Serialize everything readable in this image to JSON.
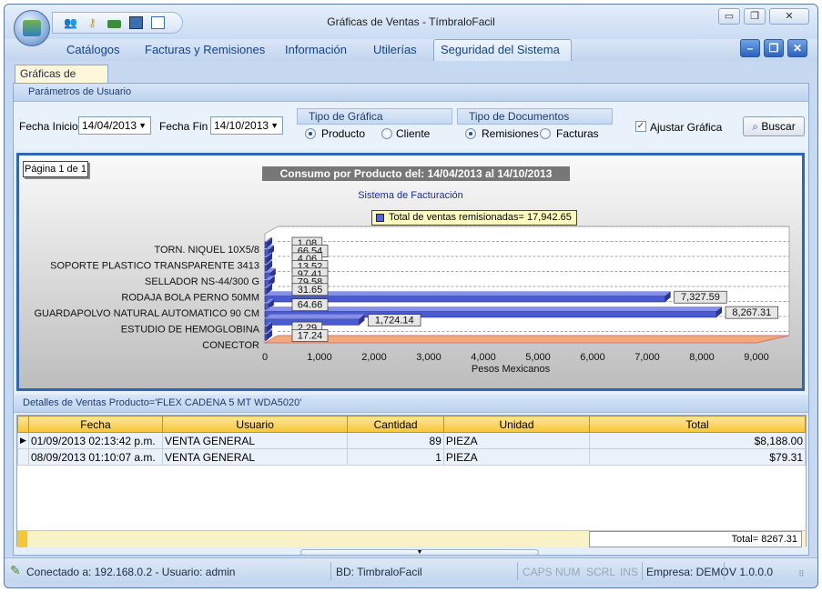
{
  "window": {
    "title": "Gráficas de Ventas - TímbraloFacil",
    "controls": {
      "minimize": "▭",
      "restore": "❐",
      "close": "✕"
    }
  },
  "quick_access": [
    "users-icon",
    "key-icon",
    "money-icon",
    "calculator-icon",
    "document-icon"
  ],
  "menu": [
    "Catálogos",
    "Facturas y Remisiones",
    "Información",
    "Utilerías",
    "Seguridad del Sistema"
  ],
  "mdi_controls": {
    "minimize": "–",
    "restore": "❐",
    "close": "✕"
  },
  "doc_tab": "Gráficas de Ventas",
  "params": {
    "header": "Parámetros de Usuario",
    "fecha_inicio_label": "Fecha Inicio",
    "fecha_inicio": "14/04/2013",
    "fecha_fin_label": "Fecha Fin",
    "fecha_fin": "14/10/2013",
    "tipo_grafica": {
      "title": "Tipo de Gráfica",
      "opt1": "Producto",
      "opt2": "Cliente",
      "selected": "Producto"
    },
    "tipo_docs": {
      "title": "Tipo de Documentos",
      "opt1": "Remisiones",
      "opt2": "Facturas",
      "selected": "Remisiones"
    },
    "ajustar": "Ajustar Gráfica",
    "ajustar_checked": true,
    "buscar": "Buscar"
  },
  "chart_data": {
    "type": "bar",
    "orientation": "horizontal",
    "page_label": "Página 1 de 1",
    "title": "Consumo por Producto del: 14/04/2013 al 14/10/2013",
    "subtitle": "Sistema de Facturación",
    "legend": "Total de ventas remisionadas= 17,942.65",
    "xlabel": "Pesos Mexicanos",
    "xlim": [
      0,
      9000
    ],
    "xticks": [
      "0",
      "1,000",
      "2,000",
      "3,000",
      "4,000",
      "5,000",
      "6,000",
      "7,000",
      "8,000",
      "9,000"
    ],
    "categories": [
      "TORN. NIQUEL 10X5/8",
      "SOPORTE PLASTICO TRANSPARENTE 3413",
      "SELLADOR NS-44/300 G",
      "RODAJA BOLA PERNO 50MM",
      "GUARDAPOLVO NATURAL AUTOMATICO 90 CM",
      "ESTUDIO DE HEMOGLOBINA",
      "CONECTOR"
    ],
    "values": [
      1.08,
      66.54,
      4.06,
      13.52,
      97.41,
      79.58,
      31.65,
      7327.59,
      64.66,
      8267.31,
      1724.14,
      2.29,
      17.24
    ],
    "value_labels": [
      "1.08",
      "66.54",
      "4.06",
      "13.52",
      "97.41",
      "79.58",
      "31.65",
      "7,327.59",
      "64.66",
      "8,267.31",
      "1,724.14",
      "2.29",
      "17.24"
    ],
    "grid": true,
    "bar_color": "#4a5bd0",
    "floor_color": "#f4a97a"
  },
  "detail": {
    "header": "Detalles de Ventas Producto='FLEX CADENA 5 MT WDA5020'",
    "columns": [
      "Fecha",
      "Usuario",
      "Cantidad",
      "Unidad",
      "Total"
    ],
    "rows": [
      {
        "fecha": "01/09/2013 02:13:42 p.m.",
        "usuario": "VENTA GENERAL",
        "cantidad": "89",
        "unidad": "PIEZA",
        "total": "$8,188.00"
      },
      {
        "fecha": "08/09/2013 01:10:07 a.m.",
        "usuario": "VENTA GENERAL",
        "cantidad": "1",
        "unidad": "PIEZA",
        "total": "$79.31"
      }
    ],
    "total": "Total= 8267.31"
  },
  "status": {
    "conexion": "Conectado a: 192.168.0.2 - Usuario: admin",
    "bd": "BD: TimbraloFacil",
    "caps": "CAPS",
    "num": "NUM",
    "scrl": "SCRL",
    "ins": "INS",
    "empresa": "Empresa: DEMO",
    "version": "V 1.0.0.0"
  }
}
